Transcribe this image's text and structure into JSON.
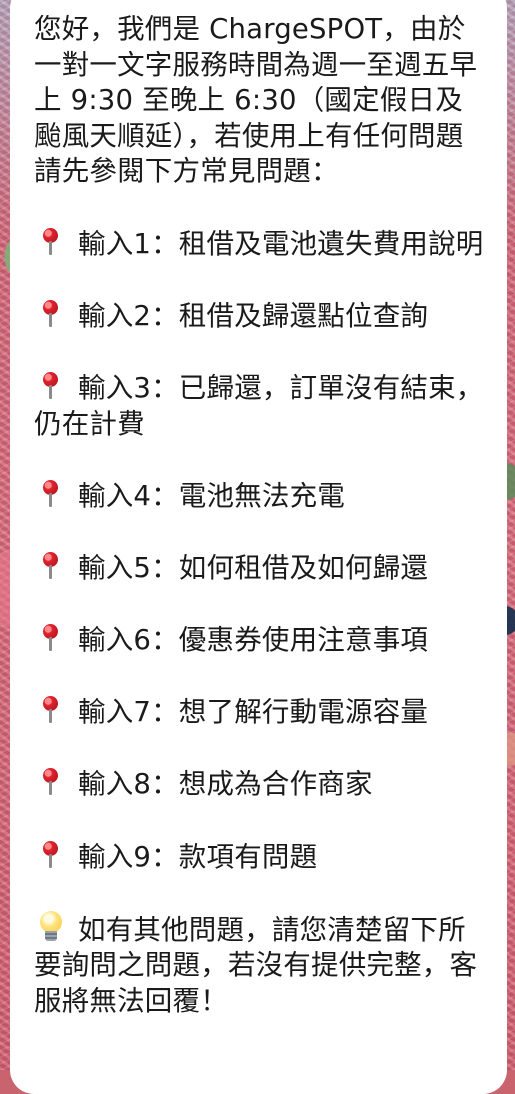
{
  "message": {
    "intro": "您好，我們是 ChargeSPOT，由於一對一文字服務時間為週一至週五早上 9:30 至晚上 6:30（國定假日及颱風天順延），若使用上有任何問題請先參閱下方常見問題：",
    "items": [
      {
        "icon": "pushpin-icon",
        "text": "輸入1：租借及電池遺失費用說明"
      },
      {
        "icon": "pushpin-icon",
        "text": "輸入2：租借及歸還點位查詢"
      },
      {
        "icon": "pushpin-icon",
        "text": "輸入3：已歸還，訂單沒有結束，仍在計費"
      },
      {
        "icon": "pushpin-icon",
        "text": "輸入4：電池無法充電"
      },
      {
        "icon": "pushpin-icon",
        "text": "輸入5：如何租借及如何歸還"
      },
      {
        "icon": "pushpin-icon",
        "text": "輸入6：優惠券使用注意事項"
      },
      {
        "icon": "pushpin-icon",
        "text": "輸入7：想了解行動電源容量"
      },
      {
        "icon": "pushpin-icon",
        "text": "輸入8：想成為合作商家"
      },
      {
        "icon": "pushpin-icon",
        "text": "輸入9：款項有問題"
      }
    ],
    "closing": {
      "icon": "lightbulb-icon",
      "text": "如有其他問題，請您清楚留下所要詢問之問題，若沒有提供完整，客服將無法回覆！"
    }
  }
}
